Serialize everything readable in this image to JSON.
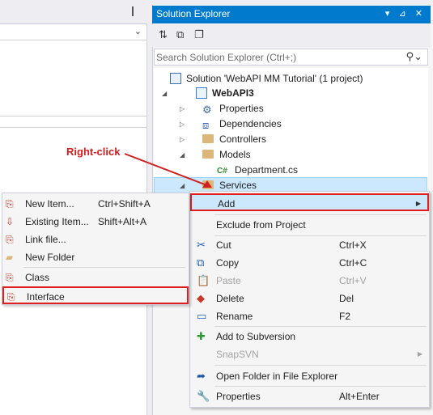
{
  "left_panel": {},
  "solution_explorer": {
    "title": "Solution Explorer",
    "title_buttons": "▾ ⊿ ✕",
    "search_placeholder": "Search Solution Explorer (Ctrl+;)",
    "tree": [
      {
        "label": "Solution 'WebAPI MM Tutorial' (1 project)",
        "icon": "solution-icon"
      },
      {
        "label": "WebAPI3",
        "icon": "web-project-icon",
        "bold": true
      },
      {
        "label": "Properties",
        "icon": "wrench-icon"
      },
      {
        "label": "Dependencies",
        "icon": "dependencies-icon"
      },
      {
        "label": "Controllers",
        "icon": "folder-icon"
      },
      {
        "label": "Models",
        "icon": "folder-icon"
      },
      {
        "label": "Department.cs",
        "icon": "csharp-file-icon"
      },
      {
        "label": "Services",
        "icon": "folder-icon"
      }
    ]
  },
  "context_menu": {
    "items": [
      {
        "label": "Add",
        "shortcut": "",
        "submenu": true
      },
      {
        "label": "Exclude from Project",
        "shortcut": ""
      },
      {
        "label": "Cut",
        "shortcut": "Ctrl+X",
        "icon": "scissors-icon"
      },
      {
        "label": "Copy",
        "shortcut": "Ctrl+C",
        "icon": "copy-icon"
      },
      {
        "label": "Paste",
        "shortcut": "Ctrl+V",
        "icon": "paste-icon",
        "disabled": true
      },
      {
        "label": "Delete",
        "shortcut": "Del",
        "icon": "delete-icon"
      },
      {
        "label": "Rename",
        "shortcut": "F2",
        "icon": "rename-icon"
      },
      {
        "label": "Add to Subversion",
        "shortcut": "",
        "icon": "plus-icon"
      },
      {
        "label": "SnapSVN",
        "shortcut": "",
        "submenu": true,
        "disabled": true
      },
      {
        "label": "Open Folder in File Explorer",
        "shortcut": "",
        "icon": "open-folder-icon"
      },
      {
        "label": "Properties",
        "shortcut": "Alt+Enter",
        "icon": "properties-icon"
      }
    ]
  },
  "add_submenu": {
    "items": [
      {
        "label": "New Item...",
        "shortcut": "Ctrl+Shift+A",
        "icon": "new-item-icon"
      },
      {
        "label": "Existing Item...",
        "shortcut": "Shift+Alt+A",
        "icon": "existing-item-icon"
      },
      {
        "label": "Link file...",
        "shortcut": "",
        "icon": "link-file-icon"
      },
      {
        "label": "New Folder",
        "shortcut": "",
        "icon": "new-folder-icon"
      },
      {
        "label": "Class",
        "shortcut": "",
        "icon": "class-icon"
      },
      {
        "label": "Interface",
        "shortcut": "",
        "icon": "interface-icon"
      }
    ]
  },
  "annotation": {
    "label": "Right-click"
  },
  "colors": {
    "accent": "#007acc",
    "highlight": "#cce8ff",
    "callout": "#e01f1f"
  }
}
